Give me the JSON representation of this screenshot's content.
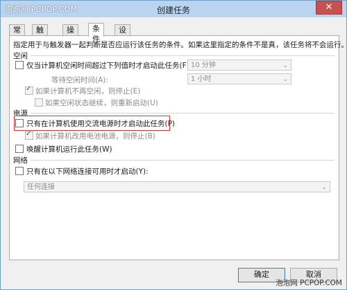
{
  "watermark_top": "泡泡网 PCPOP.COM",
  "watermark_bottom": "泡泡网 PCPOP.COM",
  "window": {
    "title": "创建任务",
    "close_glyph": "✕"
  },
  "tabs": [
    {
      "label": "常规",
      "active": false
    },
    {
      "label": "触发器",
      "active": false
    },
    {
      "label": "操作",
      "active": false
    },
    {
      "label": "条件",
      "active": true
    },
    {
      "label": "设置",
      "active": false
    }
  ],
  "conditions": {
    "description": "指定用于与触发器一起判断是否应运行该任务的条件。如果这里指定的条件不是真，该任务将不会运行。",
    "idle": {
      "section_label": "空闲",
      "start_if_idle": {
        "label": "仅当计算机空闲时间超过下列值时才启动此任务(F):",
        "checked": false
      },
      "idle_duration": "10 分钟",
      "wait_label": "等待空闲时间(A):",
      "wait_value": "1 小时",
      "stop_if_not_idle": {
        "label": "如果计算机不再空闲，则停止(E)",
        "checked": true
      },
      "restart_if_idle": {
        "label": "如果空闲状态继续，则重新启动(U)",
        "checked": false
      }
    },
    "power": {
      "section_label": "电源",
      "start_on_ac": {
        "label": "只有在计算机使用交流电源时才启动此任务(P)",
        "checked": false
      },
      "stop_on_battery": {
        "label": "如果计算机改用电池电源，则停止(B)",
        "checked": true
      },
      "wake_to_run": {
        "label": "唤醒计算机运行此任务(W)",
        "checked": false
      }
    },
    "network": {
      "section_label": "网络",
      "start_if_network": {
        "label": "只有在以下网络连接可用时才启动(Y):",
        "checked": false
      },
      "network_value": "任何连接"
    }
  },
  "buttons": {
    "ok": "确定",
    "cancel": "取消"
  },
  "icons": {
    "dropdown": "⌄",
    "checkmark": "✓"
  }
}
